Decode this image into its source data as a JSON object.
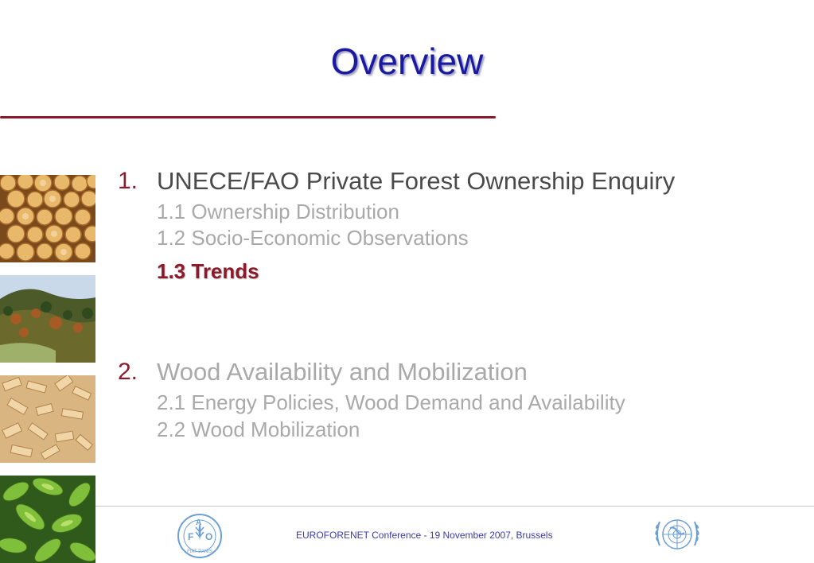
{
  "slide": {
    "title": "Overview"
  },
  "sections": [
    {
      "number": "1.",
      "title": "UNECE/FAO Private Forest Ownership Enquiry",
      "items": [
        "1.1 Ownership Distribution",
        "1.2 Socio-Economic Observations",
        "1.3 Trends"
      ]
    },
    {
      "number": "2.",
      "title": "Wood Availability and Mobilization",
      "items": [
        "2.1 Energy Policies, Wood Demand and Availability",
        "2.2 Wood Mobilization"
      ]
    }
  ],
  "footer": {
    "text": "EUROFORENET Conference -  19 November 2007, Brussels"
  },
  "logos": {
    "fao_letters": [
      "F",
      "A",
      "O"
    ],
    "fao_motto": "FIAT PANIS"
  },
  "colors": {
    "title": "#1a1aa0",
    "accent": "#8c1a2b",
    "active_text": "#4a4a4a",
    "inactive_text": "#a9a9a9",
    "footer_text": "#3a3ab0",
    "logo_blue": "#6b9fd6"
  },
  "icons": [
    "fao-logo",
    "un-emblem"
  ]
}
